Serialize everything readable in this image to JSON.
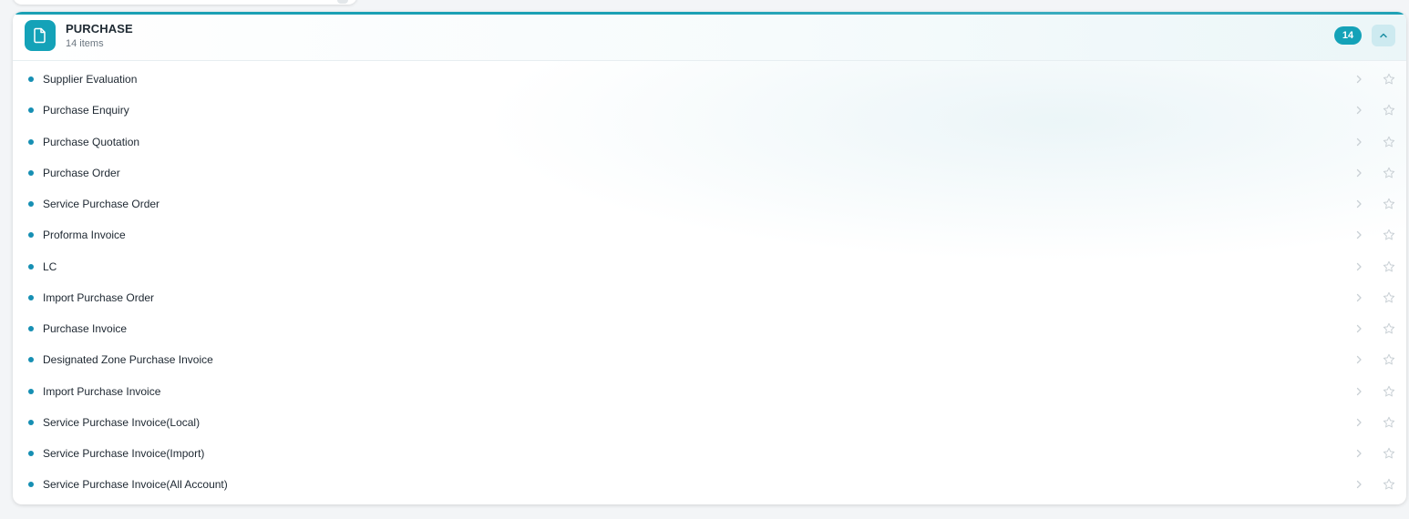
{
  "section": {
    "title": "PURCHASE",
    "subtitle": "14 items",
    "count": "14",
    "icon": "document-icon",
    "collapse_icon": "chevron-up-icon",
    "accent_color": "#14a2b8"
  },
  "items": [
    {
      "label": "Supplier Evaluation"
    },
    {
      "label": "Purchase Enquiry"
    },
    {
      "label": "Purchase Quotation"
    },
    {
      "label": "Purchase Order"
    },
    {
      "label": "Service Purchase Order"
    },
    {
      "label": "Proforma Invoice"
    },
    {
      "label": "LC"
    },
    {
      "label": "Import Purchase Order"
    },
    {
      "label": "Purchase Invoice"
    },
    {
      "label": "Designated Zone Purchase Invoice"
    },
    {
      "label": "Import Purchase Invoice"
    },
    {
      "label": "Service Purchase Invoice(Local)"
    },
    {
      "label": "Service Purchase Invoice(Import)"
    },
    {
      "label": "Service Purchase Invoice(All Account)"
    }
  ],
  "row_icons": {
    "chevron": "chevron-right-icon",
    "favorite": "star-outline-icon"
  }
}
